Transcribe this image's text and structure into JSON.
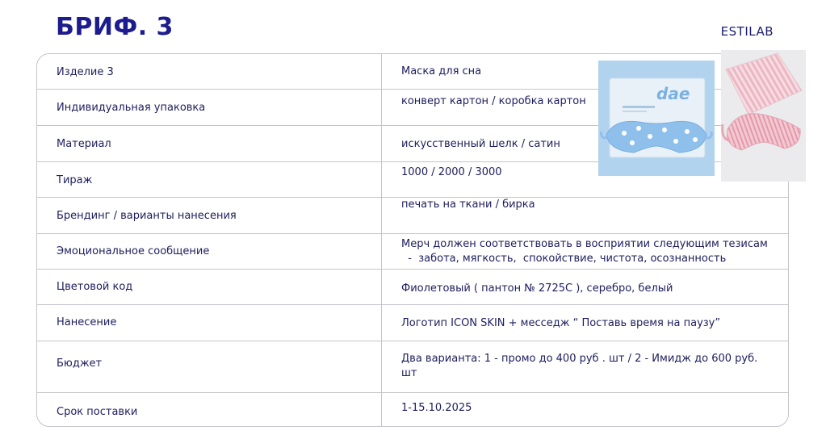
{
  "header": {
    "title": "БРИФ. 3",
    "brand": "ESTILAB"
  },
  "rows": [
    {
      "label": "Изделие 3",
      "value": "Маска для сна"
    },
    {
      "label": "Индивидуальная упаковка",
      "value": "конверт картон /  коробка картон"
    },
    {
      "label": "Материал",
      "value": "искусственный шелк /  сатин"
    },
    {
      "label": "Тираж",
      "value": "1000 / 2000 / 3000"
    },
    {
      "label": "Брендинг / варианты нанесения",
      "value": "печать на ткани /  бирка"
    },
    {
      "label": "Эмоциональное сообщение",
      "value": "Мерч должен соответствовать в восприятии следующим тезисам",
      "value2": "  -  забота, мягкость,  спокойствие, чистота, осознанность"
    },
    {
      "label": "Цветовой код",
      "value": "Фиолетовый ( пантон № 2725C ), серебро, белый"
    },
    {
      "label": "Нанесение",
      "value": "Логотип ICON SKIN +  месседж “ Поставь время на паузу”"
    },
    {
      "label": "Бюджет",
      "value": "Два варианта: 1  - промо до 400 руб . шт /  2  - Имидж до 600 руб.",
      "value2": "шт"
    },
    {
      "label": "Срок поставки",
      "value": "1-15.10.2025"
    }
  ],
  "images": {
    "photo1": {
      "description_icon": "sleep-mask-box-photo",
      "logo_text": "dae"
    },
    "photo2": {
      "description_icon": "pink-striped-sleep-mask-photo"
    }
  }
}
